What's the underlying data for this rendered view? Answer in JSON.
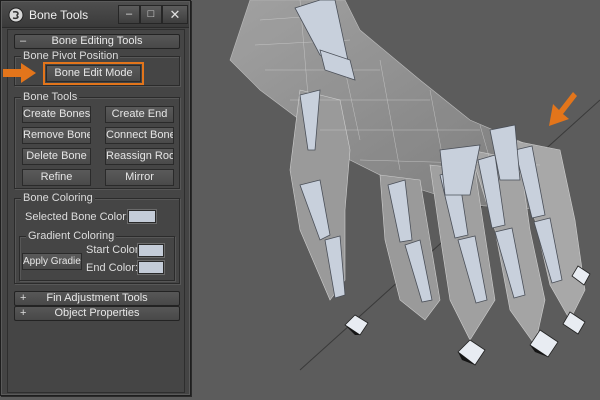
{
  "window": {
    "title": "Bone Tools",
    "minimize_glyph": "–",
    "maximize_glyph": "□",
    "close_glyph": "✕"
  },
  "rollouts": {
    "bone_editing": {
      "toggle": "–",
      "title": "Bone Editing Tools",
      "pivot_group": {
        "label": "Bone Pivot Position",
        "bone_edit_mode": "Bone Edit Mode"
      },
      "tools_group": {
        "label": "Bone Tools",
        "create_bones": "Create Bones",
        "create_end": "Create End",
        "remove_bone": "Remove Bone",
        "connect_bones": "Connect Bones",
        "delete_bone": "Delete Bone",
        "reassign_root": "Reassign Root",
        "refine": "Refine",
        "mirror": "Mirror"
      },
      "coloring_group": {
        "label": "Bone Coloring",
        "selected_bone_color": "Selected Bone Color:",
        "selected_color_value": "#c4ccd8",
        "gradient_group": {
          "label": "Gradient Coloring",
          "apply_gradient": "Apply Gradient",
          "start_color": "Start Color:",
          "start_color_value": "#c4ccd8",
          "end_color": "End Color:",
          "end_color_value": "#c4ccd8"
        }
      }
    },
    "fin_adjustment": {
      "toggle": "+",
      "title": "Fin Adjustment Tools"
    },
    "object_properties": {
      "toggle": "+",
      "title": "Object Properties"
    }
  },
  "colors": {
    "highlight_orange": "#e3751b",
    "panel_bg": "#454545",
    "viewport_bg": "#5c5c5c"
  },
  "icons": [
    "app-logo-icon",
    "arrow-right-icon",
    "arrow-down-left-icon"
  ]
}
